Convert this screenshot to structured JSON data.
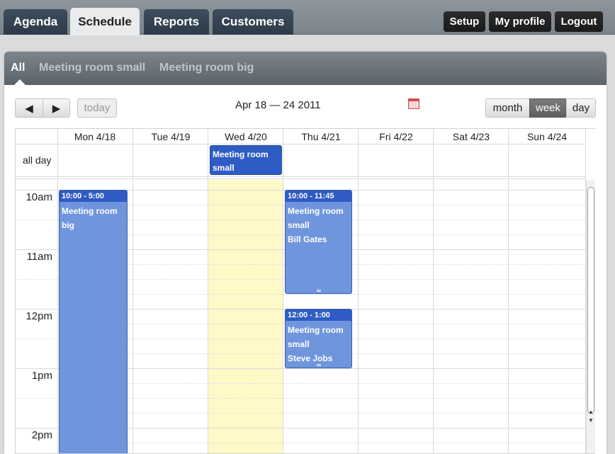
{
  "nav": {
    "tabs": [
      {
        "label": "Agenda"
      },
      {
        "label": "Schedule"
      },
      {
        "label": "Reports"
      },
      {
        "label": "Customers"
      }
    ],
    "active_tab": "Schedule",
    "buttons": {
      "setup": "Setup",
      "profile": "My profile",
      "logout": "Logout"
    }
  },
  "filters": {
    "items": [
      {
        "label": "All"
      },
      {
        "label": "Meeting room small"
      },
      {
        "label": "Meeting room big"
      }
    ],
    "active": "All"
  },
  "toolbar": {
    "prev": "◀",
    "next": "▶",
    "today": "today",
    "date_range": "Apr 18 — 24 2011",
    "views": {
      "month": "month",
      "week": "week",
      "day": "day"
    },
    "active_view": "week"
  },
  "calendar": {
    "days": [
      "Mon 4/18",
      "Tue 4/19",
      "Wed 4/20",
      "Thu 4/21",
      "Fri 4/22",
      "Sat 4/23",
      "Sun 4/24"
    ],
    "all_day_label": "all day",
    "hours": [
      "10am",
      "11am",
      "12pm",
      "1pm",
      "2pm"
    ],
    "all_day_event": {
      "title_line1": "Meeting room",
      "title_line2": "small"
    },
    "events": [
      {
        "time": "10:00 - 5:00",
        "line1": "Meeting room",
        "line2": "big",
        "line3": ""
      },
      {
        "time": "10:00 - 11:45",
        "line1": "Meeting room",
        "line2": "small",
        "line3": "Bill Gates"
      },
      {
        "time": "12:00 - 1:00",
        "line1": "Meeting room",
        "line2": "small",
        "line3": "Steve Jobs"
      }
    ]
  },
  "colors": {
    "event_body": "#6f95dc",
    "event_header": "#2f5cc4",
    "today_highlight": "#fff9c8",
    "calendar_icon": "#d34b4b"
  }
}
